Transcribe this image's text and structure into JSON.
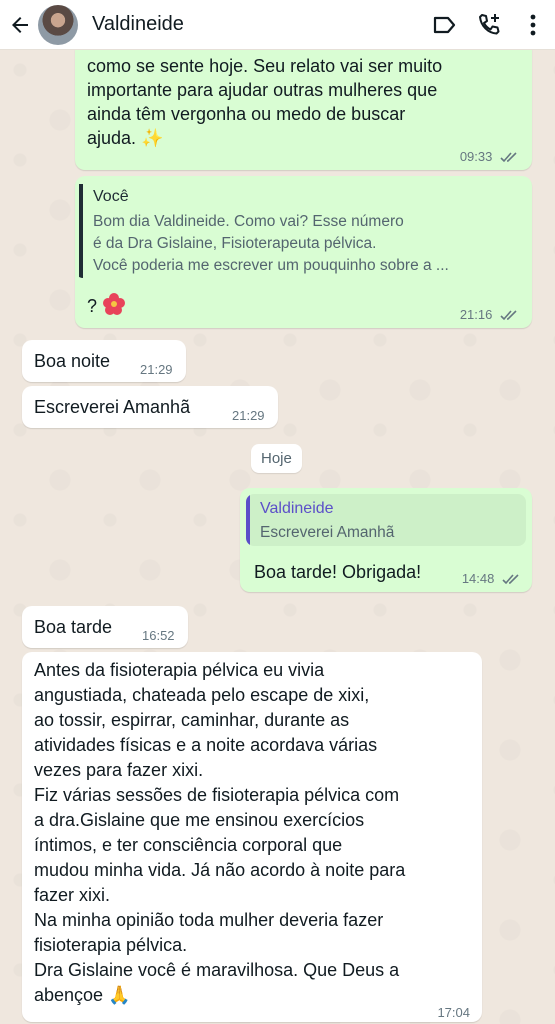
{
  "header": {
    "contact_name": "Valdineide",
    "icons": [
      "back-arrow-icon",
      "video-call-icon",
      "add-call-icon",
      "more-vert-icon"
    ]
  },
  "colors": {
    "outgoing_bubble": "#d9fdd3",
    "incoming_bubble": "#ffffff",
    "chat_background": "#efe7de",
    "read_ticks": "#667781",
    "quote_bar_you": "#1f2c34",
    "quote_bar_contact": "#5b4fc9"
  },
  "messages": {
    "m1": {
      "lines": [
        "como se sente hoje. Seu relato vai ser muito",
        "importante para ajudar outras mulheres que",
        "ainda têm vergonha ou medo de buscar",
        "ajuda. ✨"
      ],
      "time": "09:33"
    },
    "m2": {
      "quote_author": "Você",
      "quote_lines": [
        "Bom dia Valdineide. Como vai? Esse número",
        "é da Dra Gislaine, Fisioterapeuta pélvica.",
        "Você poderia me escrever um pouquinho sobre a ..."
      ],
      "text": "?",
      "time": "21:16"
    },
    "m3": {
      "text": "Boa noite",
      "time": "21:29"
    },
    "m4": {
      "text": "Escreverei Amanhã",
      "time": "21:29"
    },
    "date_divider": "Hoje",
    "m5": {
      "quote_author": "Valdineide",
      "quote_text": "Escreverei Amanhã",
      "text": "Boa tarde! Obrigada!",
      "time": "14:48"
    },
    "m6": {
      "text": "Boa tarde",
      "time": "16:52"
    },
    "m7": {
      "lines": [
        "Antes da fisioterapia pélvica eu vivia",
        "angustiada, chateada pelo escape de xixi,",
        "ao tossir, espirrar, caminhar, durante as",
        "atividades físicas e a noite acordava várias",
        "vezes para fazer xixi.",
        "Fiz várias sessões de fisioterapia pélvica com",
        "a dra.Gislaine que me ensinou exercícios",
        "íntimos, e ter consciência corporal que",
        "mudou minha vida. Já não acordo à noite para",
        "fazer xixi.",
        "Na minha opinião toda mulher deveria fazer",
        "fisioterapia pélvica.",
        "Dra Gislaine você é maravilhosa. Que Deus a",
        "abençoe 🙏"
      ],
      "time": "17:04"
    }
  }
}
